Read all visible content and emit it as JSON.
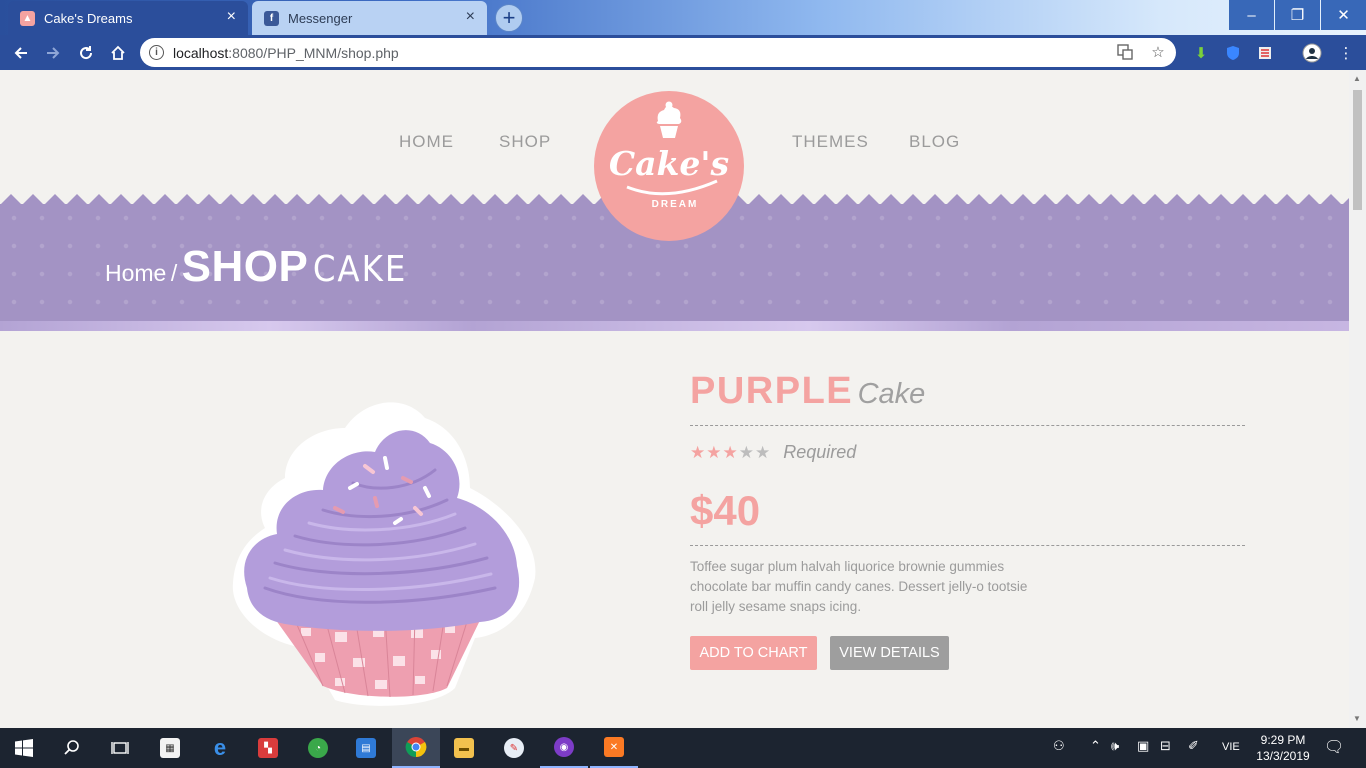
{
  "browser": {
    "tabs": [
      {
        "title": "Cake's Dreams",
        "active": true
      },
      {
        "title": "Messenger",
        "active": false
      }
    ],
    "new_tab_label": "+",
    "url_host": "localhost",
    "url_path": ":8080/PHP_MNM/shop.php",
    "window_controls": {
      "minimize": "–",
      "maximize": "❐",
      "close": "✕"
    }
  },
  "site": {
    "nav": {
      "home": "HOME",
      "shop": "SHOP",
      "themes": "THEMES",
      "blog": "BLOG"
    },
    "logo": {
      "name": "Cake's",
      "tagline": "DREAM"
    },
    "breadcrumb": {
      "home": "Home",
      "separator": "/",
      "section": "SHOP",
      "subsection": "CAKE"
    }
  },
  "product": {
    "title_main": "PURPLE",
    "title_sub": "Cake",
    "rating": 3,
    "rating_max": 5,
    "rating_label": "Required",
    "price": "$40",
    "description": "Toffee sugar plum halvah liquorice brownie gummies chocolate bar muffin candy canes. Dessert jelly-o tootsie roll jelly sesame snaps icing.",
    "add_button": "ADD TO CHART",
    "details_button": "VIEW DETAILS"
  },
  "colors": {
    "brand_pink": "#f4a3a1",
    "banner_purple": "#a393c4",
    "chrome_blue": "#2b4e9b",
    "text_gray": "#9b9b9b"
  },
  "taskbar": {
    "time": "9:29 PM",
    "date": "13/3/2019",
    "language": "VIE"
  }
}
